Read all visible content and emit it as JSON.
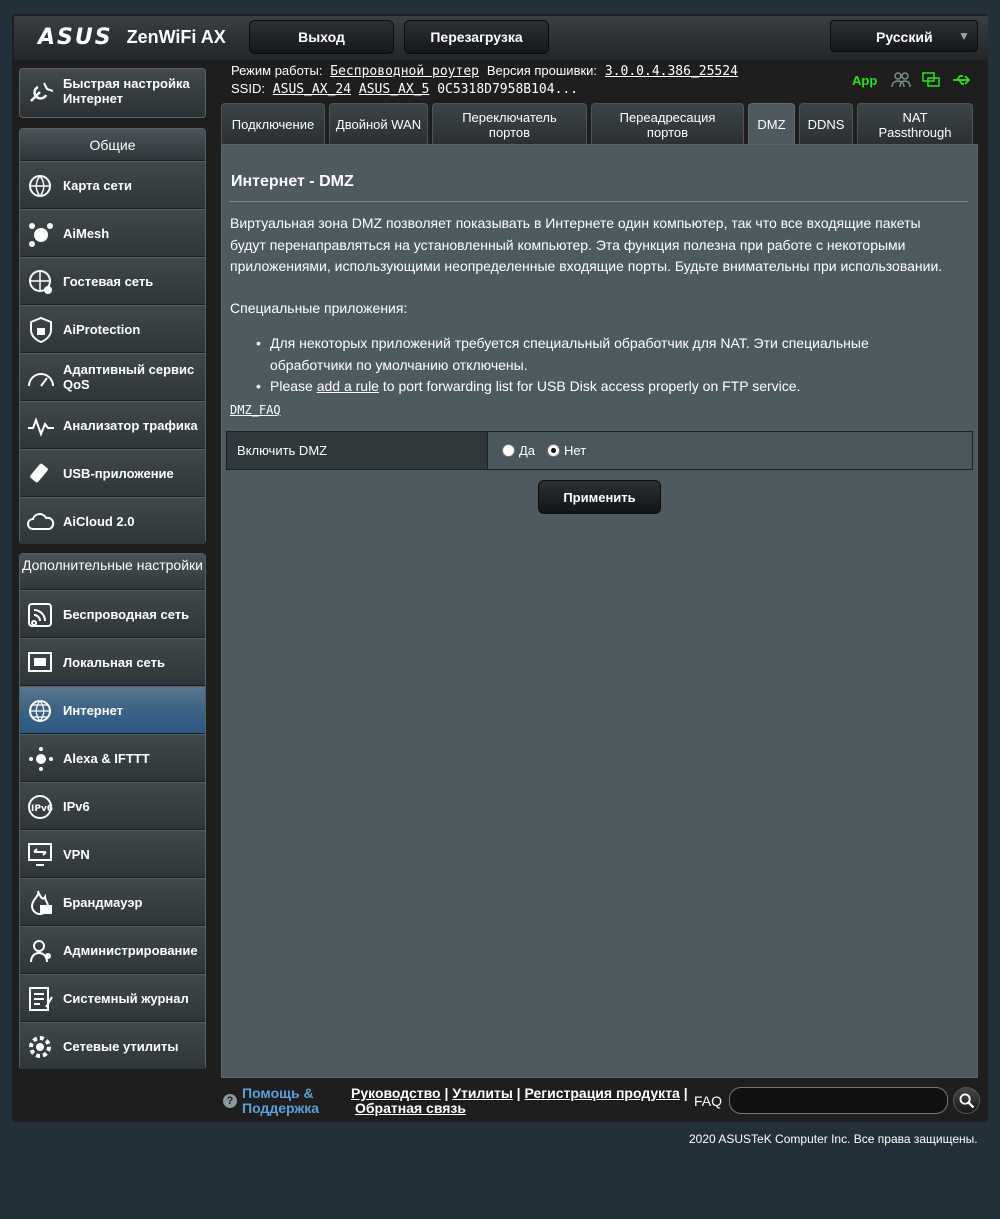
{
  "header": {
    "brand": "ASUS",
    "model": "ZenWiFi AX",
    "logout_label": "Выход",
    "reboot_label": "Перезагрузка",
    "language": "Русский"
  },
  "status": {
    "mode_label": "Режим работы:",
    "mode_value": "Беспроводной роутер",
    "fw_label": "Версия прошивки:",
    "fw_value": "3.0.0.4.386_25524",
    "ssid_label": "SSID:",
    "ssid_1": "ASUS_AX_24",
    "ssid_2": "ASUS_AX_5",
    "mac": "0C5318D7958B104...",
    "app_label": "App"
  },
  "menu": {
    "quick_setup": "Быстрая настройка Интернет",
    "general_title": "Общие",
    "general": [
      "Карта сети",
      "AiMesh",
      "Гостевая сеть",
      "AiProtection",
      "Адаптивный сервис QoS",
      "Анализатор трафика",
      "USB-приложение",
      "AiCloud 2.0"
    ],
    "advanced_title": "Дополнительные настройки",
    "advanced": [
      "Беспроводная сеть",
      "Локальная сеть",
      "Интернет",
      "Alexa & IFTTT",
      "IPv6",
      "VPN",
      "Брандмауэр",
      "Администрирование",
      "Системный журнал",
      "Сетевые утилиты"
    ],
    "active": "Интернет"
  },
  "tabs": [
    "Подключение",
    "Двойной WAN",
    "Переключатель портов",
    "Переадресация портов",
    "DMZ",
    "DDNS",
    "NAT Passthrough"
  ],
  "content": {
    "title": "Интернет - DMZ",
    "description": "Виртуальная зона DMZ позволяет показывать в Интернете один компьютер, так что все входящие пакеты будут перенаправляться на установленный компьютер. Эта функция полезна при работе с некоторыми приложениями, использующими неопределенные входящие порты. Будьте внимательны при использовании.",
    "special_title": "Специальные приложения:",
    "bullet_1": "Для некоторых приложений требуется специальный обработчик для NAT. Эти специальные обработчики по умолчанию отключены.",
    "bullet_2_pre": "Please ",
    "bullet_2_link": "add a rule",
    "bullet_2_post": " to port forwarding list for USB Disk access properly on FTP service.",
    "faq_link": "DMZ_FAQ",
    "enable_label": "Включить DMZ",
    "yes_label": "Да",
    "no_label": "Нет",
    "apply_label": "Применить"
  },
  "footer": {
    "help": "Помощь & Поддержка",
    "link_manual": "Руководство",
    "link_utils": "Утилиты",
    "link_register": "Регистрация продукта",
    "link_feedback": "Обратная связь",
    "faq_label": "FAQ",
    "faq_placeholder": "",
    "copyright": "2020 ASUSTeK Computer Inc. Все права защищены."
  }
}
